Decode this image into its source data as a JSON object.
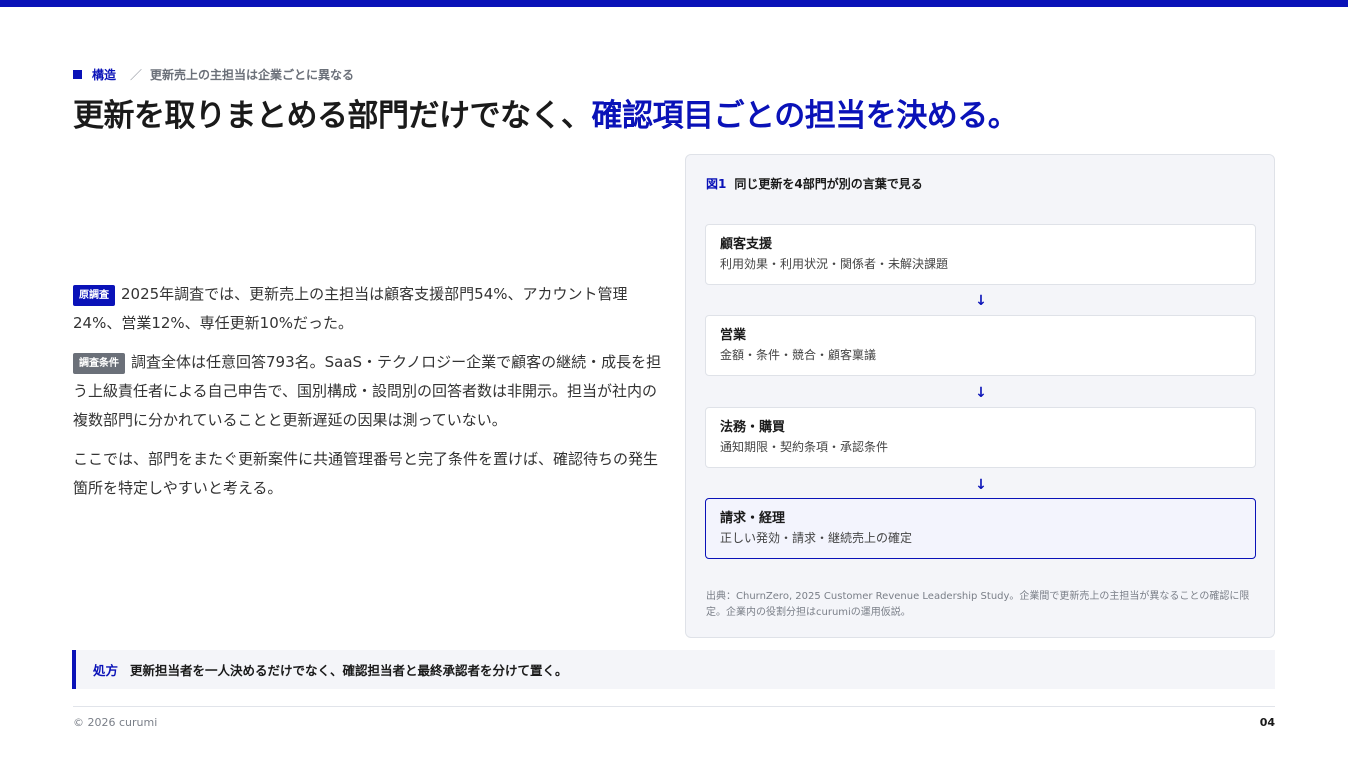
{
  "eyebrow": {
    "section": "構造",
    "separator": "／",
    "subtitle": "更新売上の主担当は企業ごとに異なる"
  },
  "title": {
    "main": "更新を取りまとめる部門だけでなく、",
    "accent": "確認項目ごとの担当を決める。"
  },
  "body": {
    "p1_badge": "原調査",
    "p1_text": "2025年調査では、更新売上の主担当は顧客支援部門54%、アカウント管理24%、営業12%、専任更新10%だった。",
    "p2_badge": "調査条件",
    "p2_text": "調査全体は任意回答793名。SaaS・テクノロジー企業で顧客の継続・成長を担う上級責任者による自己申告で、国別構成・設問別の回答者数は非開示。担当が社内の複数部門に分かれていることと更新遅延の因果は測っていない。",
    "p3_text": "ここでは、部門をまたぐ更新案件に共通管理番号と完了条件を置けば、確認待ちの発生箇所を特定しやすいと考える。"
  },
  "figure": {
    "label": "図1",
    "caption": "同じ更新を4部門が別の言葉で見る",
    "arrow": "↓",
    "steps": [
      {
        "title": "顧客支援",
        "desc": "利用効果・利用状況・関係者・未解決課題"
      },
      {
        "title": "営業",
        "desc": "金額・条件・競合・顧客稟議"
      },
      {
        "title": "法務・購買",
        "desc": "通知期限・契約条項・承認条件"
      },
      {
        "title": "請求・経理",
        "desc": "正しい発効・請求・継続売上の確定"
      }
    ],
    "source": "出典：ChurnZero, 2025 Customer Revenue Leadership Study。企業間で更新売上の主担当が異なることの確認に限定。企業内の役割分担はcurumiの運用仮説。"
  },
  "prescription": {
    "label": "処方",
    "text": "更新担当者を一人決めるだけでなく、確認担当者と最終承認者を分けて置く。"
  },
  "footer": {
    "copyright": "© 2026 curumi",
    "page": "04"
  },
  "colors": {
    "accent": "#0a12b8",
    "muted": "#6b7079",
    "panel": "#f4f5f9"
  }
}
